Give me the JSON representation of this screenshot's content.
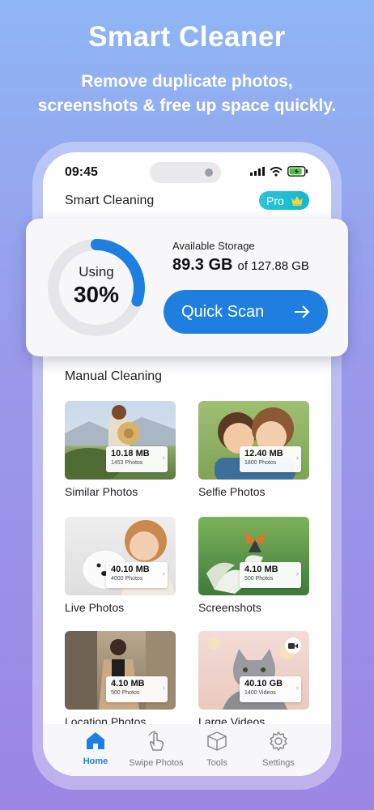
{
  "hero": {
    "title": "Smart Cleaner",
    "subtitle_line1": "Remove duplicate photos,",
    "subtitle_line2": "screenshots & free up space quickly."
  },
  "status_bar": {
    "time": "09:45",
    "battery_color": "#46c13a"
  },
  "header": {
    "title": "Smart Cleaning",
    "pro_label": "Pro",
    "pro_icon": "crown-icon"
  },
  "storage": {
    "using_label": "Using",
    "using_percent": "30%",
    "used_fraction": 0.3,
    "available_label": "Available Storage",
    "available_value": "89.3 GB",
    "available_total": "of 127.88 GB",
    "scan_label": "Quick Scan",
    "scan_icon": "arrow-right-icon",
    "accent_color": "#1f7fe0"
  },
  "manual": {
    "title": "Manual Cleaning",
    "tiles": [
      {
        "label": "Similar Photos",
        "size": "10.18 MB",
        "count": "1453 Photos"
      },
      {
        "label": "Selfie Photos",
        "size": "12.40 MB",
        "count": "1800 Photos"
      },
      {
        "label": "Live Photos",
        "size": "40.10 MB",
        "count": "4000 Photos"
      },
      {
        "label": "Screenshots",
        "size": "4.10 MB",
        "count": "500 Photos"
      },
      {
        "label": "Location Photos",
        "size": "4.10 MB",
        "count": "500 Photos"
      },
      {
        "label": "Large Videos",
        "size": "40.10 GB",
        "count": "1400 Videos"
      }
    ]
  },
  "tabs": [
    {
      "label": "Home",
      "icon": "home-icon",
      "active": true
    },
    {
      "label": "Swipe Photos",
      "icon": "swipe-hand-icon",
      "active": false
    },
    {
      "label": "Tools",
      "icon": "box-icon",
      "active": false
    },
    {
      "label": "Settings",
      "icon": "gear-icon",
      "active": false
    }
  ]
}
